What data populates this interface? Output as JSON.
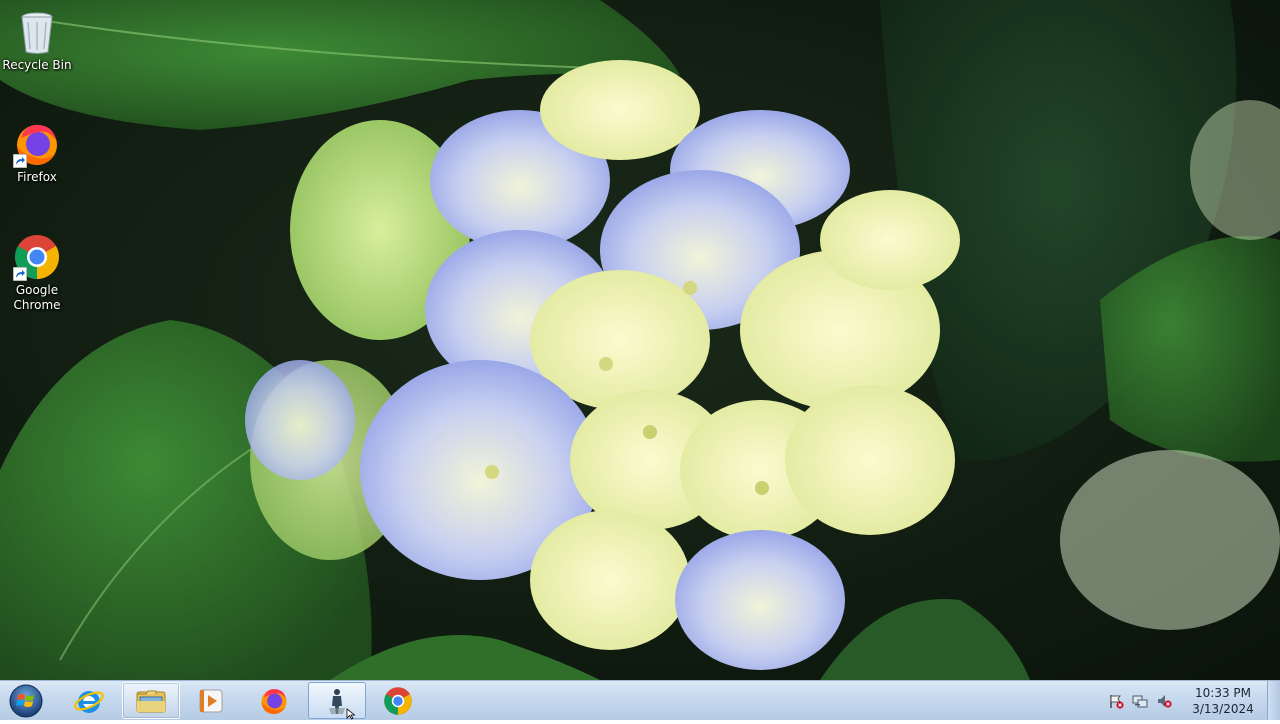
{
  "desktop": {
    "icons": [
      {
        "label": "Recycle Bin",
        "icon": "recycle-bin-icon"
      },
      {
        "label": "Firefox",
        "icon": "firefox-icon"
      },
      {
        "label": "Google Chrome",
        "icon": "chrome-icon"
      }
    ],
    "wallpaper": "hydrangea-flower"
  },
  "taskbar": {
    "start": {
      "icon": "windows-start-orb-icon"
    },
    "items": [
      {
        "name": "Internet Explorer",
        "icon": "internet-explorer-icon",
        "state": "pinned"
      },
      {
        "name": "Windows Explorer",
        "icon": "folder-icon",
        "state": "open"
      },
      {
        "name": "Windows Media Player",
        "icon": "media-player-icon",
        "state": "pinned"
      },
      {
        "name": "Firefox",
        "icon": "firefox-icon",
        "state": "pinned"
      },
      {
        "name": "Application",
        "icon": "app-figure-icon",
        "state": "active"
      },
      {
        "name": "Google Chrome",
        "icon": "chrome-icon",
        "state": "pinned"
      }
    ],
    "tray": {
      "icons": [
        "action-center-flag-icon",
        "network-icon",
        "volume-muted-icon"
      ],
      "time": "10:33 PM",
      "date": "3/13/2024"
    }
  },
  "colors": {
    "taskbar_top": "#dbe8f6",
    "taskbar_bottom": "#b6cbe4",
    "leaf_green": "#2f6b2a",
    "petal_blue": "#a7b6ee",
    "petal_yellow": "#f1f2b4"
  }
}
